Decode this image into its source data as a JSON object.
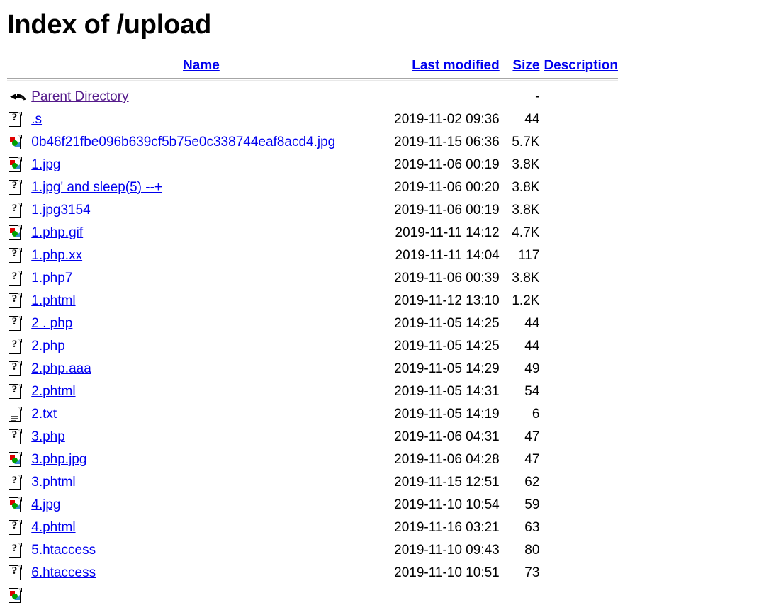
{
  "page": {
    "title": "Index of /upload"
  },
  "columns": {
    "icon": "",
    "name": "Name",
    "last_modified": "Last modified",
    "size": "Size",
    "description": "Description"
  },
  "colors": {
    "link": "#0000EE",
    "visited_link": "#551A8B",
    "text": "#000000",
    "rule": "#A6A6A6",
    "background": "#FFFFFF"
  },
  "rows": [
    {
      "icon": "back-icon",
      "name": "Parent Directory",
      "visited": true,
      "last_modified": "",
      "size": "-",
      "description": ""
    },
    {
      "icon": "unknown-icon",
      "name": ".s",
      "visited": false,
      "last_modified": "2019-11-02 09:36",
      "size": "44",
      "description": ""
    },
    {
      "icon": "image-icon",
      "name": "0b46f21fbe096b639cf5b75e0c338744eaf8acd4.jpg",
      "visited": false,
      "last_modified": "2019-11-15 06:36",
      "size": "5.7K",
      "description": ""
    },
    {
      "icon": "image-icon",
      "name": "1.jpg",
      "visited": false,
      "last_modified": "2019-11-06 00:19",
      "size": "3.8K",
      "description": ""
    },
    {
      "icon": "unknown-icon",
      "name": "1.jpg' and sleep(5) --+",
      "visited": false,
      "last_modified": "2019-11-06 00:20",
      "size": "3.8K",
      "description": ""
    },
    {
      "icon": "unknown-icon",
      "name": "1.jpg3154",
      "visited": false,
      "last_modified": "2019-11-06 00:19",
      "size": "3.8K",
      "description": ""
    },
    {
      "icon": "image-icon",
      "name": "1.php.gif",
      "visited": false,
      "last_modified": "2019-11-11 14:12",
      "size": "4.7K",
      "description": ""
    },
    {
      "icon": "unknown-icon",
      "name": "1.php.xx",
      "visited": false,
      "last_modified": "2019-11-11 14:04",
      "size": "117",
      "description": ""
    },
    {
      "icon": "unknown-icon",
      "name": "1.php7",
      "visited": false,
      "last_modified": "2019-11-06 00:39",
      "size": "3.8K",
      "description": ""
    },
    {
      "icon": "unknown-icon",
      "name": "1.phtml",
      "visited": false,
      "last_modified": "2019-11-12 13:10",
      "size": "1.2K",
      "description": ""
    },
    {
      "icon": "unknown-icon",
      "name": "2 . php",
      "visited": false,
      "last_modified": "2019-11-05 14:25",
      "size": "44",
      "description": ""
    },
    {
      "icon": "unknown-icon",
      "name": "2.php",
      "visited": false,
      "last_modified": "2019-11-05 14:25",
      "size": "44",
      "description": ""
    },
    {
      "icon": "unknown-icon",
      "name": "2.php.aaa",
      "visited": false,
      "last_modified": "2019-11-05 14:29",
      "size": "49",
      "description": ""
    },
    {
      "icon": "unknown-icon",
      "name": "2.phtml",
      "visited": false,
      "last_modified": "2019-11-05 14:31",
      "size": "54",
      "description": ""
    },
    {
      "icon": "text-icon",
      "name": "2.txt",
      "visited": false,
      "last_modified": "2019-11-05 14:19",
      "size": "6",
      "description": ""
    },
    {
      "icon": "unknown-icon",
      "name": "3.php",
      "visited": false,
      "last_modified": "2019-11-06 04:31",
      "size": "47",
      "description": ""
    },
    {
      "icon": "image-icon",
      "name": "3.php.jpg",
      "visited": false,
      "last_modified": "2019-11-06 04:28",
      "size": "47",
      "description": ""
    },
    {
      "icon": "unknown-icon",
      "name": "3.phtml",
      "visited": false,
      "last_modified": "2019-11-15 12:51",
      "size": "62",
      "description": ""
    },
    {
      "icon": "image-icon",
      "name": "4.jpg",
      "visited": false,
      "last_modified": "2019-11-10 10:54",
      "size": "59",
      "description": ""
    },
    {
      "icon": "unknown-icon",
      "name": "4.phtml",
      "visited": false,
      "last_modified": "2019-11-16 03:21",
      "size": "63",
      "description": ""
    },
    {
      "icon": "unknown-icon",
      "name": "5.htaccess",
      "visited": false,
      "last_modified": "2019-11-10 09:43",
      "size": "80",
      "description": ""
    },
    {
      "icon": "unknown-icon",
      "name": "6.htaccess",
      "visited": false,
      "last_modified": "2019-11-10 10:51",
      "size": "73",
      "description": ""
    },
    {
      "icon": "image-icon",
      "name": "",
      "visited": false,
      "last_modified": "",
      "size": "",
      "description": ""
    }
  ]
}
